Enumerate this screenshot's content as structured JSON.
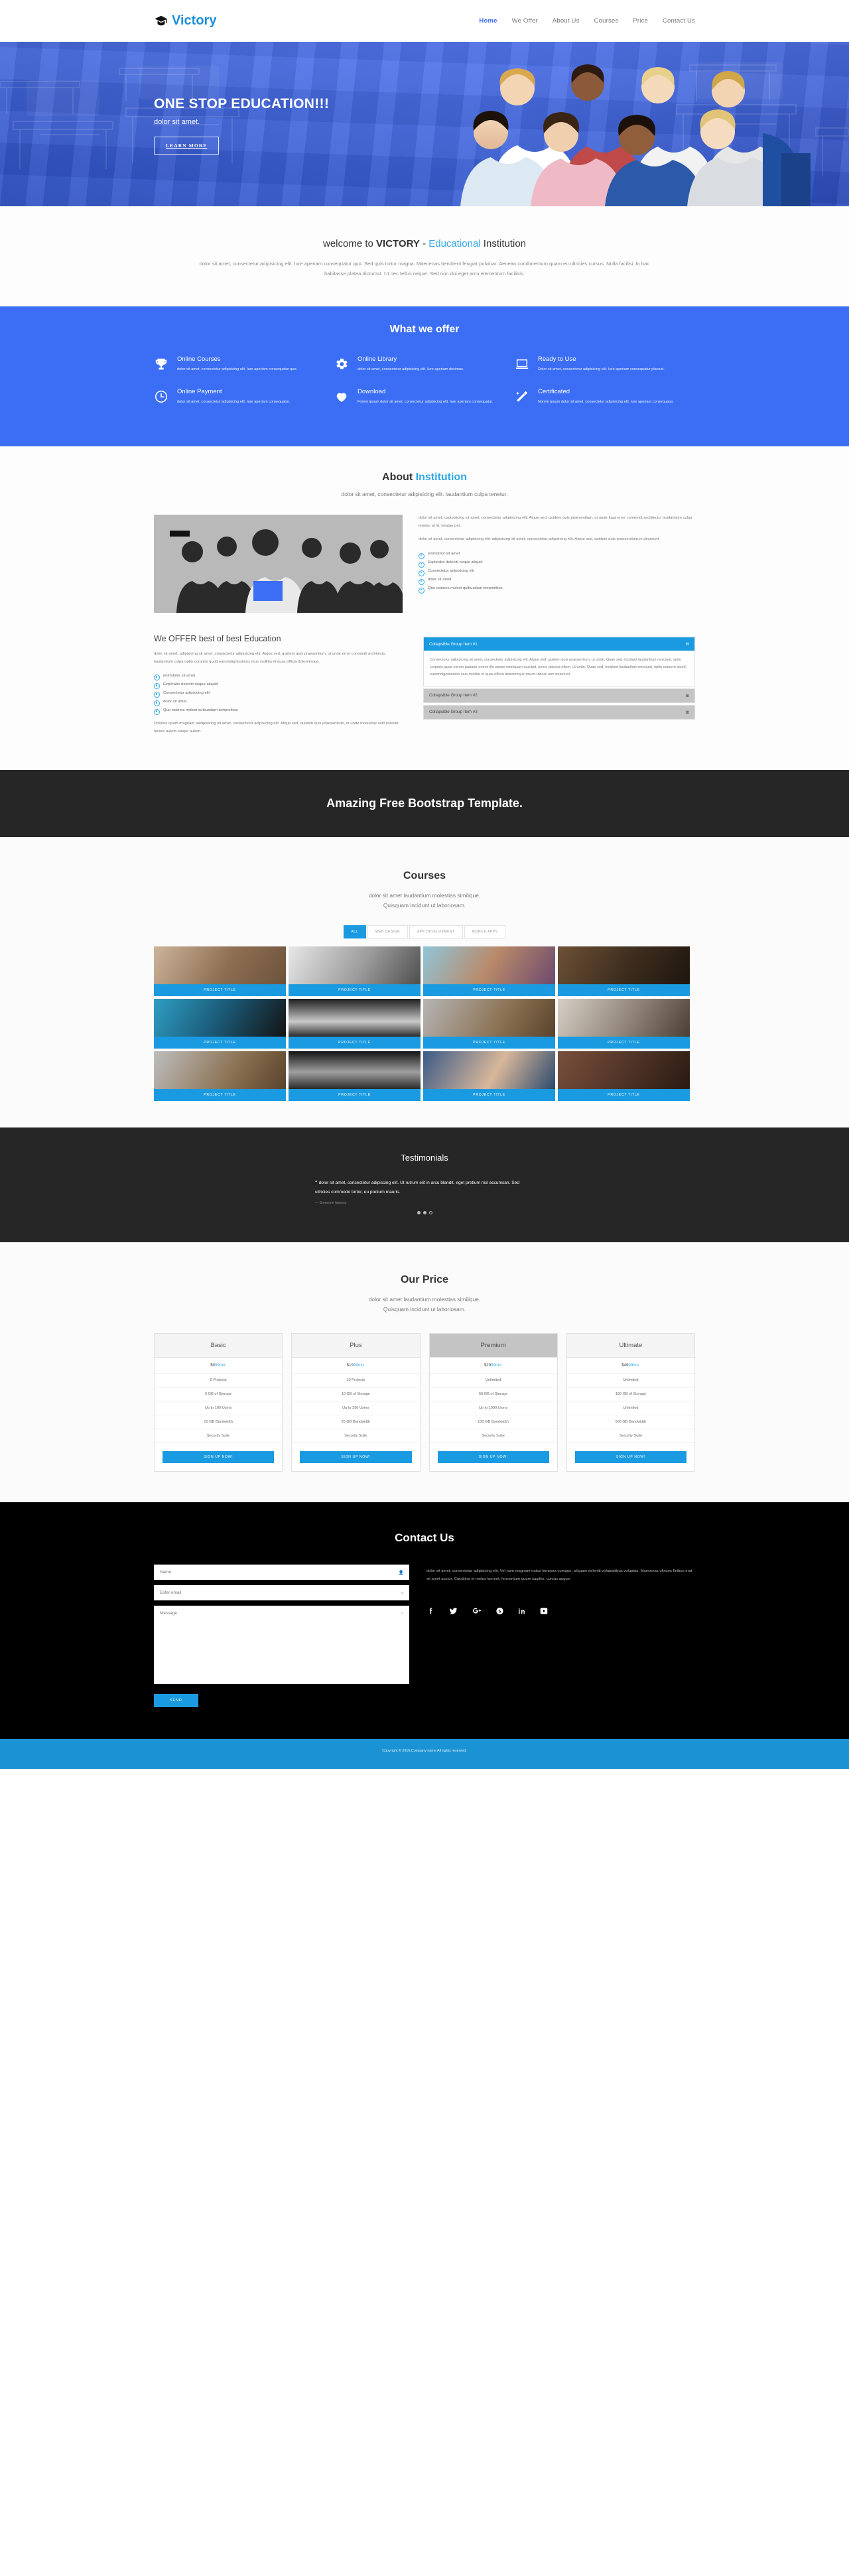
{
  "nav": {
    "brand": "Victory",
    "brand_icon": "graduation-cap-icon",
    "links": [
      {
        "label": "Home",
        "active": true
      },
      {
        "label": "We Offer",
        "active": false
      },
      {
        "label": "About Us",
        "active": false
      },
      {
        "label": "Courses",
        "active": false
      },
      {
        "label": "Price",
        "active": false
      },
      {
        "label": "Contact Us",
        "active": false
      }
    ]
  },
  "hero": {
    "title": "ONE STOP EDUCATION!!!",
    "subtitle": "dolor sit amet.",
    "button": "LEARN MORE"
  },
  "welcome": {
    "pre": "welcome to ",
    "brand": "VICTORY",
    "dash": " - ",
    "accent": "Educational",
    "post": " Institution",
    "body": "dolor sit amet, consectetur adipisicing elit. Iure aperiam consequatur quo. Sed quis tortor magna. Maecenas hendrerit feugiat pulvinar. Aenean condimentum quam eu ultricies cursus. Nulla facilisi. In hac habitasse platea dictumst. Ut nec tellus neque. Sed non dui eget arcu elementum facilisis."
  },
  "offer": {
    "title": "What we offer",
    "items": [
      {
        "icon": "trophy-icon",
        "title": "Online Courses",
        "text": "dolor sit amet, consectetur adipisicing elit. Iure aperiam consequatur quo."
      },
      {
        "icon": "gear-icon",
        "title": "Online Library",
        "text": "dolor sit amet, consectetur adipisicing elit. Iure aperiam ducimus."
      },
      {
        "icon": "laptop-icon",
        "title": "Ready to Use",
        "text": "Dolor sit amet, consectetur adipisicing elit. Iure aperiam consequatur placeat."
      },
      {
        "icon": "clock-icon",
        "title": "Online Payment",
        "text": "dolor sit amet, consectetur adipisicing elit. Iure aperiam consequatur."
      },
      {
        "icon": "heart-icon",
        "title": "Download",
        "text": "Forem ipsum dolor sit amet, consectetur adipisicing elit. Iure aperiam consequatur."
      },
      {
        "icon": "magic-wand-icon",
        "title": "Certificated",
        "text": "Norem ipsum dolor sit amet, consectetur adipisicing elit. Iure aperiam consequatur."
      }
    ]
  },
  "about": {
    "title_plain": "About ",
    "title_accent": "Institution",
    "lead": "dolor sit amet, consectetur adipisicing elit. laudantium culpa tenetur.",
    "photo_alt": "students-group-photo",
    "p1": "dolor sit amet, cadipisicing sit amet, consectetur adipisicing elit. Atque sed, quidem quis praesentium, ut unde fuga error commodi architecto, laudantium culpa tenetur at id, beatae pet.",
    "p2": "dolor sit amet, consectetur adipisicing elit. adipisicing sit amet, consectetur adipisicing elit. Atque sed, quidem quis praesentium,m deserunt.",
    "bullets": [
      "enimdolor sit amet",
      "Explicabo deleniti neque aliquid",
      "Consectetur adipisicing elit",
      "dolor sit amet",
      "Quo issimos molest quibusdam temporibus"
    ]
  },
  "best": {
    "title": "We OFFER best of best Education",
    "p1": "dolor sit amet, adipisicing sit amet, consectetur adipisicing elit. Atque sed, quidem quis praesentium, ut unde error commodi architecto, laudantium culpa optio corporis quod earumdignissimos eius mollitia et quas officia doloremque.",
    "bullets": [
      "enimdolor sit amet",
      "Explicabo deleniti neque aliquid",
      "Consectetur adipisicing elit",
      "dolor sit amet",
      "Quo issimos molest quibusdam temporibus"
    ],
    "p2": "Dolores quam magnam aadipisicing sit amet, consectetur adipisicing elit. Atque sed, quidem quis praesentium, ut unde molestias velit eveniet, facere autem saepe autem.",
    "accordion": [
      {
        "label": "Collapsible Group Item #1",
        "toggle": "minus-icon",
        "open": true,
        "body": "Consectetur adipisicing sit amet, consectetur adipisicing elit. Atque sed, quidem quis praesentium, ut unde. Quae sed, incidunt laudantium nesciunt, optio corporis quod earum pariatur omnis illo saepe numquam suscipit, nemo placeat ntium, ut unde. Quae sed, incidunt laudantium nesciunt, optio corporis quod earumdignissimos eius mollitia et quas officia doloremque ipsum labore rem deserunt."
      },
      {
        "label": "Collapsible Group Item #2",
        "toggle": "plus-icon",
        "open": false,
        "body": ""
      },
      {
        "label": "Collapsible Group Item #3",
        "toggle": "plus-icon",
        "open": false,
        "body": ""
      }
    ]
  },
  "banner": {
    "text": "Amazing Free Bootstrap Template."
  },
  "courses": {
    "title": "Courses",
    "lead_line1": "dolor sit amet laudantium molestias similique.",
    "lead_line2": "Quisquam incidunt ut laboriosam.",
    "filters": [
      {
        "label": "ALL",
        "active": true
      },
      {
        "label": "WEB DESIGN",
        "active": false
      },
      {
        "label": "APP DEVELOPMENT",
        "active": false
      },
      {
        "label": "MOBILE APPS",
        "active": false
      }
    ],
    "item_caption": "PROJECT TITLE",
    "items": [
      {
        "thumb": "desk-phone-photo"
      },
      {
        "thumb": "mug-keyboard-photo"
      },
      {
        "thumb": "coffee-cup-photo"
      },
      {
        "thumb": "laptop-notebook-photo"
      },
      {
        "thumb": "hand-tablet-photo"
      },
      {
        "thumb": "window-silhouette-photo"
      },
      {
        "thumb": "desk-glasses-photo"
      },
      {
        "thumb": "laptop-desk-photo"
      },
      {
        "thumb": "desk-glasses-photo-2"
      },
      {
        "thumb": "city-window-photo"
      },
      {
        "thumb": "camera-hands-photo"
      },
      {
        "thumb": "brick-table-photo"
      }
    ]
  },
  "testimonials": {
    "title": "Testimonials",
    "quote_mark": "“",
    "quote": "dolor sit amet, consectetur adipiscing elit. Ut rutrum elit in arcu blandit, eget pretium nisl accumsan. Sed ultricies commodo tortor, eu pretium mauris.",
    "author": "— Someone famous",
    "dots": [
      true,
      true,
      false
    ]
  },
  "price": {
    "title": "Our Price",
    "lead_line1": "dolor sit amet laudantium molestias similique.",
    "lead_line2": "Quisquam incidunt ut laboriosam.",
    "cta": "SIGN UP NOW!",
    "plans": [
      {
        "name": "Basic",
        "featured": false,
        "price_main": "$9",
        "price_cents": "99",
        "price_per": "mo.",
        "features": [
          "5 Projects",
          "5 GB of Storage",
          "Up to 100 Users",
          "10 GB Bandwidth",
          "Security Suite"
        ]
      },
      {
        "name": "Plus",
        "featured": false,
        "price_main": "$19",
        "price_cents": "99",
        "price_per": "mo.",
        "features": [
          "10 Projects",
          "10 GB of Storage",
          "Up to 250 Users",
          "25 GB Bandwidth",
          "Security Suite"
        ]
      },
      {
        "name": "Premium",
        "featured": true,
        "price_main": "$29",
        "price_cents": "99",
        "price_per": "mo.",
        "features": [
          "Unlimited",
          "50 GB of Storage",
          "Up to 1000 Users",
          "100 GB Bandwidth",
          "Security Suite"
        ]
      },
      {
        "name": "Ultimate",
        "featured": false,
        "price_main": "$49",
        "price_cents": "99",
        "price_per": "mo.",
        "features": [
          "Unlimited",
          "150 GB of Storage",
          "Unlimited",
          "500 GB Bandwidth",
          "Security Suite"
        ]
      }
    ]
  },
  "contact": {
    "title": "Contact Us",
    "name_placeholder": "Name",
    "name_value": "",
    "name_icon": "user-icon",
    "email_placeholder": "Enter email",
    "email_value": "",
    "email_icon": "envelope-icon",
    "message_placeholder": "Message",
    "message_value": "",
    "message_icon": "pencil-icon",
    "send": "SEND",
    "text": "dolor sit amet, consectetur adipisicing elit. Vel nam magnam natus tempora cumque, aliquam deleniti voluptatibus voluptas. Maecenas ultrices finibus erat sit amet auctor. Curabitur et metus laoreet, fermentum quam sagittis, cursus augue.",
    "socials": [
      "facebook-icon",
      "twitter-icon",
      "google-plus-icon",
      "skype-icon",
      "linkedin-icon",
      "youtube-icon"
    ]
  },
  "footer": {
    "copyright": "Copyright © 2016.Company name All rights reserved."
  },
  "colors": {
    "brand_blue": "#1a8fd8",
    "hero_blue": "#3b6ef5",
    "accent_cyan": "#2fa8e8",
    "card_blue": "#1a9ae0",
    "dark": "#262626",
    "black": "#000000",
    "footer_blue": "#1a92d4"
  }
}
